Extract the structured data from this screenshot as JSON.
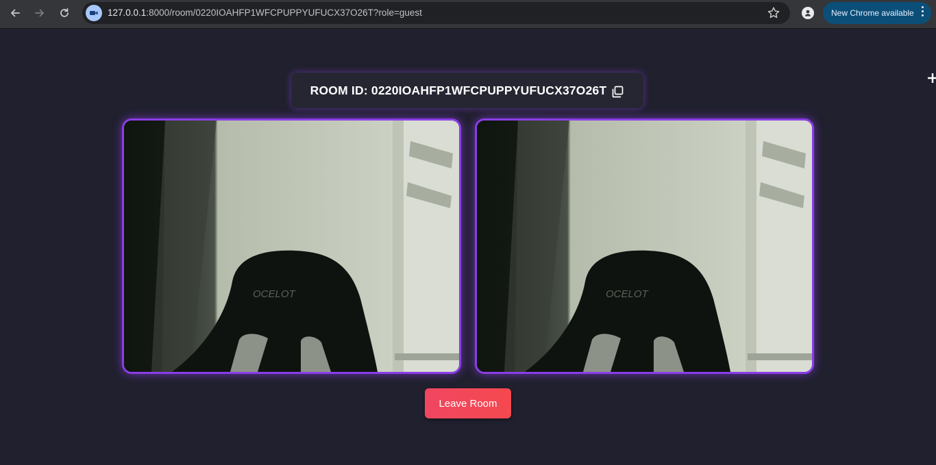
{
  "browser": {
    "url_host": "127.0.0.1",
    "url_rest": ":8000/room/0220IOAHFP1WFCPUPPYUFUCX37O26T?role=guest",
    "update_label": "New Chrome available",
    "icons": {
      "back": "back-arrow-icon",
      "forward": "forward-arrow-icon",
      "reload": "reload-icon",
      "site": "video-camera-icon",
      "bookmark": "star-icon",
      "profile": "profile-icon",
      "menu": "vertical-dots-icon"
    }
  },
  "room": {
    "id_label": "ROOM ID: 0220IOAHFP1WFCPUPPYUFUCX37O26T",
    "copy_icon": "copy-icon"
  },
  "videos": [
    {
      "name": "local-video",
      "brand_mark": "OCELOT"
    },
    {
      "name": "remote-video",
      "brand_mark": "OCELOT"
    }
  ],
  "actions": {
    "leave_label": "Leave Room"
  },
  "colors": {
    "page_bg": "#20202e",
    "accent_glow": "#8a3ee6",
    "leave_button": "#f04661",
    "update_pill": "#0b4f79"
  }
}
